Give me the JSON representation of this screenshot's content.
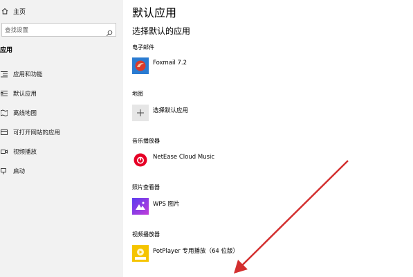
{
  "sidebar": {
    "home_label": "主页",
    "search_placeholder": "查找设置",
    "section_title": "应用",
    "items": [
      {
        "label": "应用和功能",
        "icon": "apps-list-icon"
      },
      {
        "label": "默认应用",
        "icon": "default-apps-icon"
      },
      {
        "label": "离线地图",
        "icon": "offline-maps-icon"
      },
      {
        "label": "可打开网站的应用",
        "icon": "web-apps-icon"
      },
      {
        "label": "视频播放",
        "icon": "video-playback-icon"
      },
      {
        "label": "启动",
        "icon": "startup-icon"
      }
    ]
  },
  "main": {
    "title": "默认应用",
    "subtitle": "选择默认的应用",
    "categories": [
      {
        "label": "电子邮件",
        "app": "Foxmail 7.2",
        "icon": "foxmail-icon"
      },
      {
        "label": "地图",
        "app": "选择默认应用",
        "icon": "plus-icon"
      },
      {
        "label": "音乐播放器",
        "app": "NetEase Cloud Music",
        "icon": "netease-music-icon"
      },
      {
        "label": "照片查看器",
        "app": "WPS 图片",
        "icon": "wps-pictures-icon"
      },
      {
        "label": "视频播放器",
        "app": "PotPlayer 专用播放（64 位版）",
        "icon": "potplayer-icon"
      }
    ]
  },
  "colors": {
    "sidebar_bg": "#f2f2f2",
    "annotation_arrow": "#d32f2f",
    "plus_tile": "#e6e6e6"
  }
}
